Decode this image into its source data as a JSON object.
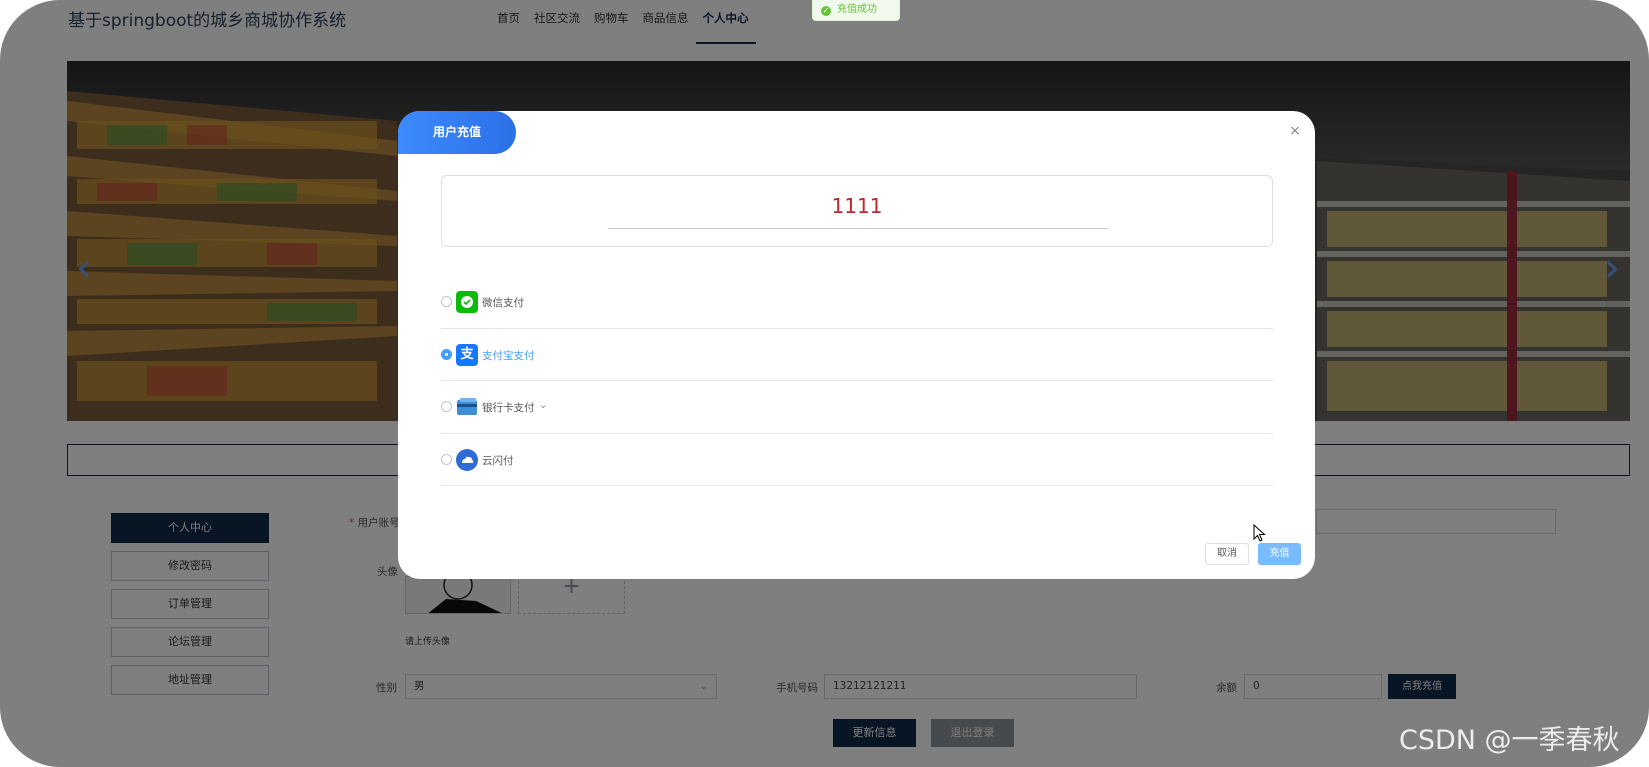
{
  "header": {
    "site_title": "基于springboot的城乡商城协作系统",
    "nav": [
      "首页",
      "社区交流",
      "购物车",
      "商品信息",
      "个人中心"
    ],
    "active_nav": "个人中心"
  },
  "toast": {
    "text": "充值成功",
    "color": "#67c23a"
  },
  "sidebar": {
    "items": [
      "个人中心",
      "修改密码",
      "订单管理",
      "论坛管理",
      "地址管理"
    ],
    "active": "个人中心"
  },
  "form": {
    "account_label": "用户账号",
    "avatar_label": "头像",
    "upload_hint": "请上传头像",
    "gender_label": "性别",
    "gender_value": "男",
    "phone_label": "手机号码",
    "phone_value": "13212121211",
    "balance_label": "余额",
    "balance_value": "0",
    "recharge_button": "点我充值",
    "update_button": "更新信息",
    "logout_button": "退出登录"
  },
  "dialog": {
    "title": "用户充值",
    "amount": "1111",
    "payment_methods": [
      {
        "label": "微信支付",
        "icon": "wechat-pay-icon",
        "color": "#09bb07",
        "selected": false
      },
      {
        "label": "支付宝支付",
        "icon": "alipay-icon",
        "color": "#1677ff",
        "selected": true
      },
      {
        "label": "银行卡支付",
        "icon": "bank-card-icon",
        "color": "#3f8ed8",
        "selected": false
      },
      {
        "label": "云闪付",
        "icon": "unionpay-cloud-icon",
        "color": "#2e6bd6",
        "selected": false
      }
    ],
    "cancel_button": "取消",
    "confirm_button": "充值"
  },
  "watermark": "CSDN @一季春秋",
  "colors": {
    "primary_dark": "#0f2a4a",
    "accent_blue": "#409eff",
    "amount_red": "#c0262d"
  }
}
